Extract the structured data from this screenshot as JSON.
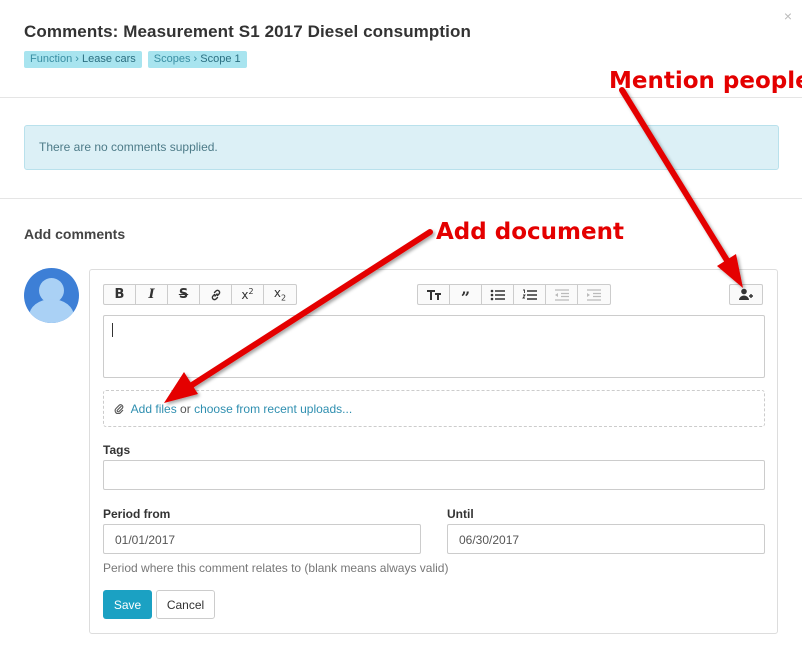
{
  "modal": {
    "title": "Comments: Measurement S1 2017 Diesel consumption",
    "close_glyph": "×",
    "breadcrumbs": [
      {
        "prefix": "Function › ",
        "value": "Lease cars"
      },
      {
        "prefix": "Scopes › ",
        "value": "Scope 1"
      }
    ]
  },
  "notice": {
    "text": "There are no comments supplied."
  },
  "add_comments": {
    "title": "Add comments",
    "toolbar": {
      "left": [
        "bold-icon",
        "italic-icon",
        "strikethrough-icon",
        "link-icon",
        "superscript-icon",
        "subscript-icon"
      ],
      "middle": [
        "text-size-icon",
        "blockquote-icon",
        "bullet-list-icon",
        "numbered-list-icon",
        "outdent-icon",
        "indent-icon"
      ],
      "right": [
        "mention-user-icon"
      ]
    },
    "attach": {
      "add_files": "Add files",
      "or": "or",
      "recent": "choose from recent uploads..."
    },
    "tags_label": "Tags",
    "tags_value": "",
    "period_from_label": "Period from",
    "period_from_value": "01/01/2017",
    "until_label": "Until",
    "until_value": "06/30/2017",
    "help_text": "Period where this comment relates to (blank means always valid)",
    "save_label": "Save",
    "cancel_label": "Cancel"
  },
  "annotations": {
    "mention": "Mention people",
    "document": "Add document",
    "color": "#e40000"
  }
}
